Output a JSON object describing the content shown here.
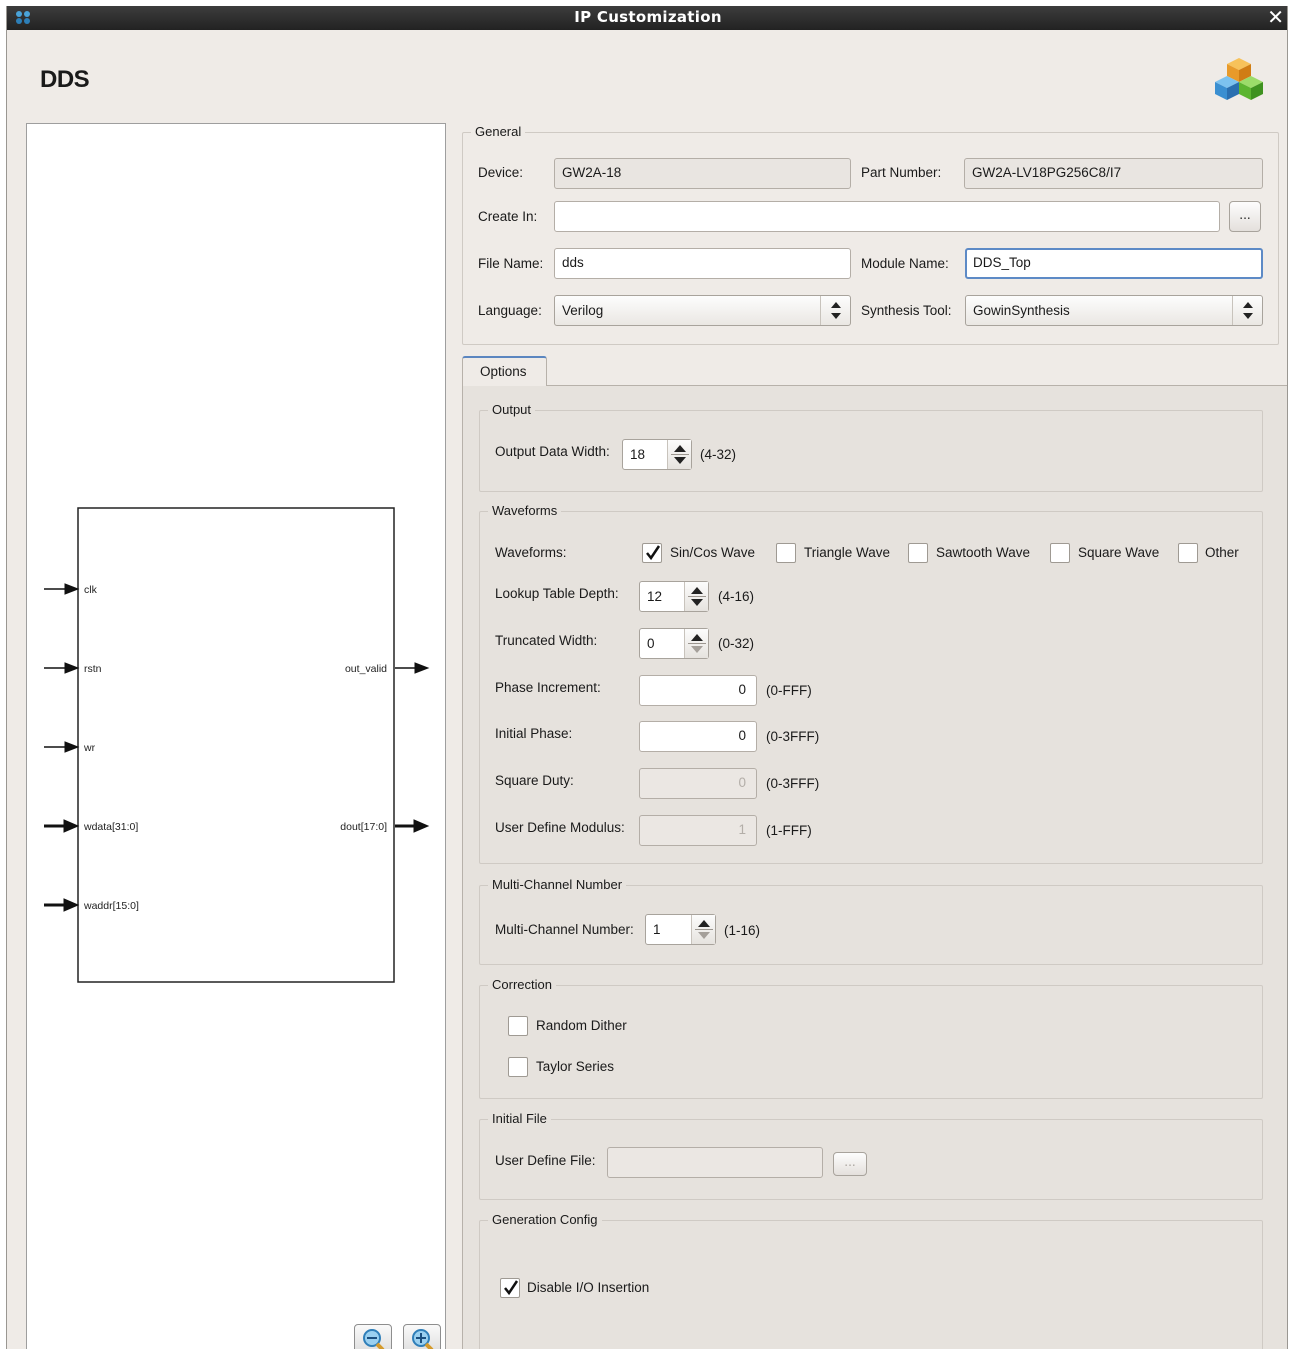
{
  "window": {
    "title": "IP Customization",
    "close_glyph": "✕"
  },
  "header": {
    "title": "DDS",
    "icon": "ip-cubes-icon"
  },
  "general": {
    "legend": "General",
    "device_label": "Device:",
    "device_value": "GW2A-18",
    "part_number_label": "Part Number:",
    "part_number_value": "GW2A-LV18PG256C8/I7",
    "create_in_label": "Create In:",
    "create_in_value": "",
    "browse_label": "...",
    "file_name_label": "File Name:",
    "file_name_value": "dds",
    "module_name_label": "Module Name:",
    "module_name_value": "DDS_Top",
    "language_label": "Language:",
    "language_value": "Verilog",
    "synthesis_tool_label": "Synthesis Tool:",
    "synthesis_tool_value": "GowinSynthesis"
  },
  "tabs": [
    {
      "label": "Options",
      "active": true
    }
  ],
  "options": {
    "output": {
      "legend": "Output",
      "data_width_label": "Output Data Width:",
      "data_width_value": "18",
      "data_width_range": "(4-32)"
    },
    "waveforms": {
      "legend": "Waveforms",
      "waveforms_label": "Waveforms:",
      "types": [
        {
          "label": "Sin/Cos Wave",
          "checked": true
        },
        {
          "label": "Triangle Wave",
          "checked": false
        },
        {
          "label": "Sawtooth Wave",
          "checked": false
        },
        {
          "label": "Square Wave",
          "checked": false
        },
        {
          "label": "Other",
          "checked": false
        }
      ],
      "lookup_depth_label": "Lookup Table Depth:",
      "lookup_depth_value": "12",
      "lookup_depth_range": "(4-16)",
      "truncated_width_label": "Truncated Width:",
      "truncated_width_value": "0",
      "truncated_width_range": "(0-32)",
      "phase_increment_label": "Phase Increment:",
      "phase_increment_value": "0",
      "phase_increment_range": "(0-FFF)",
      "initial_phase_label": "Initial Phase:",
      "initial_phase_value": "0",
      "initial_phase_range": "(0-3FFF)",
      "square_duty_label": "Square Duty:",
      "square_duty_value": "0",
      "square_duty_range": "(0-3FFF)",
      "user_modulus_label": "User Define Modulus:",
      "user_modulus_value": "1",
      "user_modulus_range": "(1-FFF)"
    },
    "multichannel": {
      "legend": "Multi-Channel Number",
      "label": "Multi-Channel Number:",
      "value": "1",
      "range": "(1-16)"
    },
    "correction": {
      "legend": "Correction",
      "random_dither_label": "Random Dither",
      "random_dither_checked": false,
      "taylor_series_label": "Taylor Series",
      "taylor_series_checked": false
    },
    "initial_file": {
      "legend": "Initial File",
      "label": "User Define File:",
      "value": "",
      "browse_label": "..."
    },
    "generation": {
      "legend": "Generation Config",
      "disable_io_label": "Disable I/O Insertion",
      "disable_io_checked": true
    }
  },
  "schematic": {
    "inputs": [
      "clk",
      "rstn",
      "wr",
      "wdata[31:0]",
      "waddr[15:0]"
    ],
    "outputs": [
      "out_valid",
      "dout[17:0]"
    ]
  },
  "preview_controls": {
    "zoom_out_icon": "zoom-out-icon",
    "zoom_in_icon": "zoom-in-icon"
  }
}
